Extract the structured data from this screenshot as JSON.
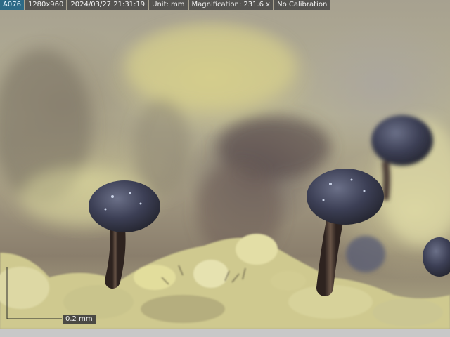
{
  "status_bar": {
    "image_id": "A076",
    "resolution": "1280x960",
    "datetime": "2024/03/27 21:31:19",
    "unit": "Unit: mm",
    "magnification": "Magnification:  231.6 x",
    "calibration": "No Calibration"
  },
  "scale_bar": {
    "label": "0.2 mm"
  },
  "colors": {
    "status_bg": "#464646",
    "id_chip_bg": "#2d6a86",
    "scale_line": "#2a2a2a",
    "fungus_cap": "#3c3f55",
    "fungus_stalk": "#4a3a32",
    "lichen": "#d8d39a"
  }
}
